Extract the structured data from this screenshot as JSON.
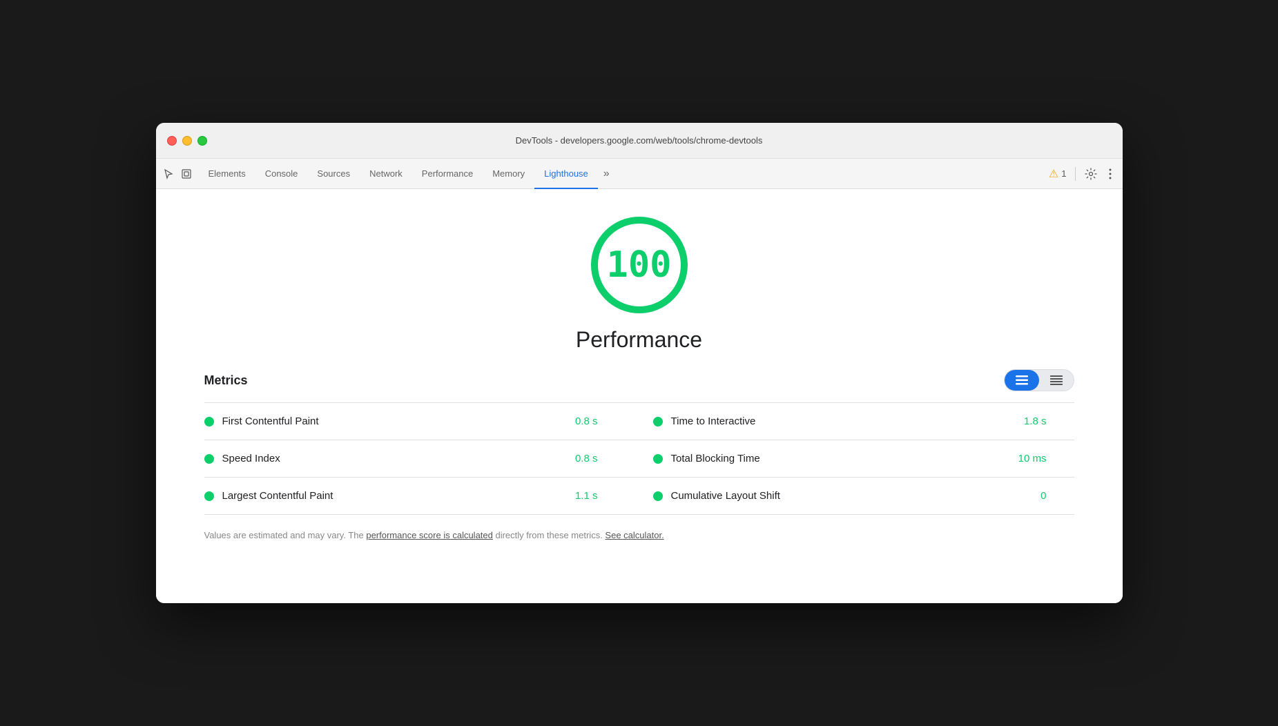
{
  "window": {
    "title": "DevTools - developers.google.com/web/tools/chrome-devtools"
  },
  "tabs": {
    "items": [
      {
        "id": "elements",
        "label": "Elements",
        "active": false
      },
      {
        "id": "console",
        "label": "Console",
        "active": false
      },
      {
        "id": "sources",
        "label": "Sources",
        "active": false
      },
      {
        "id": "network",
        "label": "Network",
        "active": false
      },
      {
        "id": "performance",
        "label": "Performance",
        "active": false
      },
      {
        "id": "memory",
        "label": "Memory",
        "active": false
      },
      {
        "id": "lighthouse",
        "label": "Lighthouse",
        "active": true
      }
    ],
    "more_label": "»"
  },
  "toolbar": {
    "warning_count": "1",
    "warning_icon": "⚠",
    "settings_icon": "⚙",
    "more_icon": "⋮",
    "cursor_icon": "⬡",
    "layers_icon": "⧉"
  },
  "score": {
    "value": "100",
    "label": "Performance"
  },
  "metrics": {
    "section_label": "Metrics",
    "view_toggle": {
      "list_label": "≡",
      "grid_label": "☰"
    },
    "rows": [
      {
        "left": {
          "name": "First Contentful Paint",
          "value": "0.8 s"
        },
        "right": {
          "name": "Time to Interactive",
          "value": "1.8 s"
        }
      },
      {
        "left": {
          "name": "Speed Index",
          "value": "0.8 s"
        },
        "right": {
          "name": "Total Blocking Time",
          "value": "10 ms"
        }
      },
      {
        "left": {
          "name": "Largest Contentful Paint",
          "value": "1.1 s"
        },
        "right": {
          "name": "Cumulative Layout Shift",
          "value": "0"
        }
      }
    ],
    "footer": {
      "text_before": "Values are estimated and may vary. The ",
      "link1_text": "performance score is calculated",
      "text_middle": " directly from these metrics. ",
      "link2_text": "See calculator.",
      "text_after": ""
    }
  },
  "colors": {
    "green": "#0cce6b",
    "blue": "#1a73e8",
    "active_tab": "#1a73e8"
  }
}
